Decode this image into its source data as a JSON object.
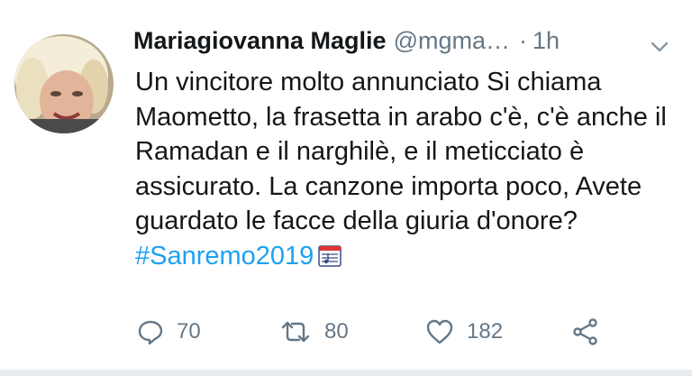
{
  "tweet": {
    "author_name": "Mariagiovanna Maglie",
    "handle": "@mgma…",
    "separator": "·",
    "time": "1h",
    "text_main": "Un vincitore molto annunciato Si chiama Maometto, la frasetta in arabo c'è, c'è anche il Ramadan e il narghilè, e il meticciato è assicurato. La canzone importa poco, Avete guardato le facce della giuria d'onore? ",
    "hashtag": "#Sanremo2019",
    "emoji_icon": "musical-score-icon"
  },
  "actions": {
    "reply_count": "70",
    "retweet_count": "80",
    "like_count": "182"
  },
  "colors": {
    "accent": "#1da1f2",
    "text": "#14171a",
    "muted": "#657786"
  }
}
